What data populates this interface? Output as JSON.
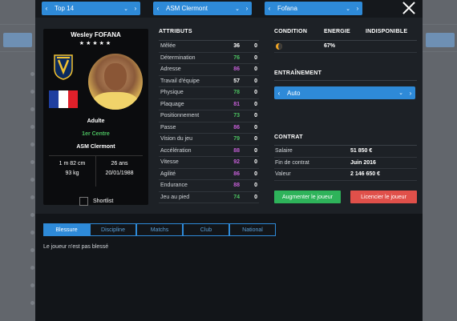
{
  "header": {
    "league_select": "Top 14",
    "club_select": "ASM Clermont",
    "player_select": "Fofana"
  },
  "player": {
    "name": "Wesley FOFANA",
    "stars": "★★★★★",
    "age_category": "Adulte",
    "position": "1er Centre",
    "club": "ASM Clermont",
    "height": "1 m 82 cm",
    "weight": "93 kg",
    "age": "26 ans",
    "birthdate": "20/01/1988",
    "shortlist_label": "Shortlist",
    "flag_colors": [
      "#1f3fa0",
      "#ffffff",
      "#e0202a"
    ]
  },
  "attributes": {
    "title": "ATTRIBUTS",
    "rows": [
      {
        "label": "Mêlée",
        "value": "36",
        "change": "0",
        "color": "#ffffff"
      },
      {
        "label": "Détermination",
        "value": "76",
        "change": "0",
        "color": "#4cc060"
      },
      {
        "label": "Adresse",
        "value": "86",
        "change": "0",
        "color": "#c55fd6"
      },
      {
        "label": "Travail d'équipe",
        "value": "57",
        "change": "0",
        "color": "#ffffff"
      },
      {
        "label": "Physique",
        "value": "78",
        "change": "0",
        "color": "#4cc060"
      },
      {
        "label": "Plaquage",
        "value": "81",
        "change": "0",
        "color": "#c55fd6"
      },
      {
        "label": "Positionnement",
        "value": "73",
        "change": "0",
        "color": "#4cc060"
      },
      {
        "label": "Passe",
        "value": "86",
        "change": "0",
        "color": "#c55fd6"
      },
      {
        "label": "Vision du jeu",
        "value": "79",
        "change": "0",
        "color": "#4cc060"
      },
      {
        "label": "Accélération",
        "value": "88",
        "change": "0",
        "color": "#c55fd6"
      },
      {
        "label": "Vitesse",
        "value": "92",
        "change": "0",
        "color": "#c55fd6"
      },
      {
        "label": "Agilité",
        "value": "86",
        "change": "0",
        "color": "#c55fd6"
      },
      {
        "label": "Endurance",
        "value": "88",
        "change": "0",
        "color": "#c55fd6"
      },
      {
        "label": "Jeu au pied",
        "value": "74",
        "change": "0",
        "color": "#4cc060"
      }
    ]
  },
  "condition": {
    "col_condition": "CONDITION",
    "col_energy": "ENERGIE",
    "col_unavailable": "INDISPONIBLE",
    "energy_value": "67%"
  },
  "training": {
    "title": "ENTRAÎNEMENT",
    "selected": "Auto"
  },
  "contract": {
    "title": "CONTRAT",
    "rows": [
      {
        "label": "Salaire",
        "value": "51 850 €"
      },
      {
        "label": "Fin de contrat",
        "value": "Juin 2016"
      },
      {
        "label": "Valeur",
        "value": "2 146 650 €"
      }
    ],
    "increase_button": "Augmenter le joueur",
    "release_button": "Licencier le joueur"
  },
  "tabs": [
    "Blessure",
    "Discipline",
    "Matchs",
    "Club",
    "National"
  ],
  "injury_text": "Le joueur n'est pas blessé"
}
